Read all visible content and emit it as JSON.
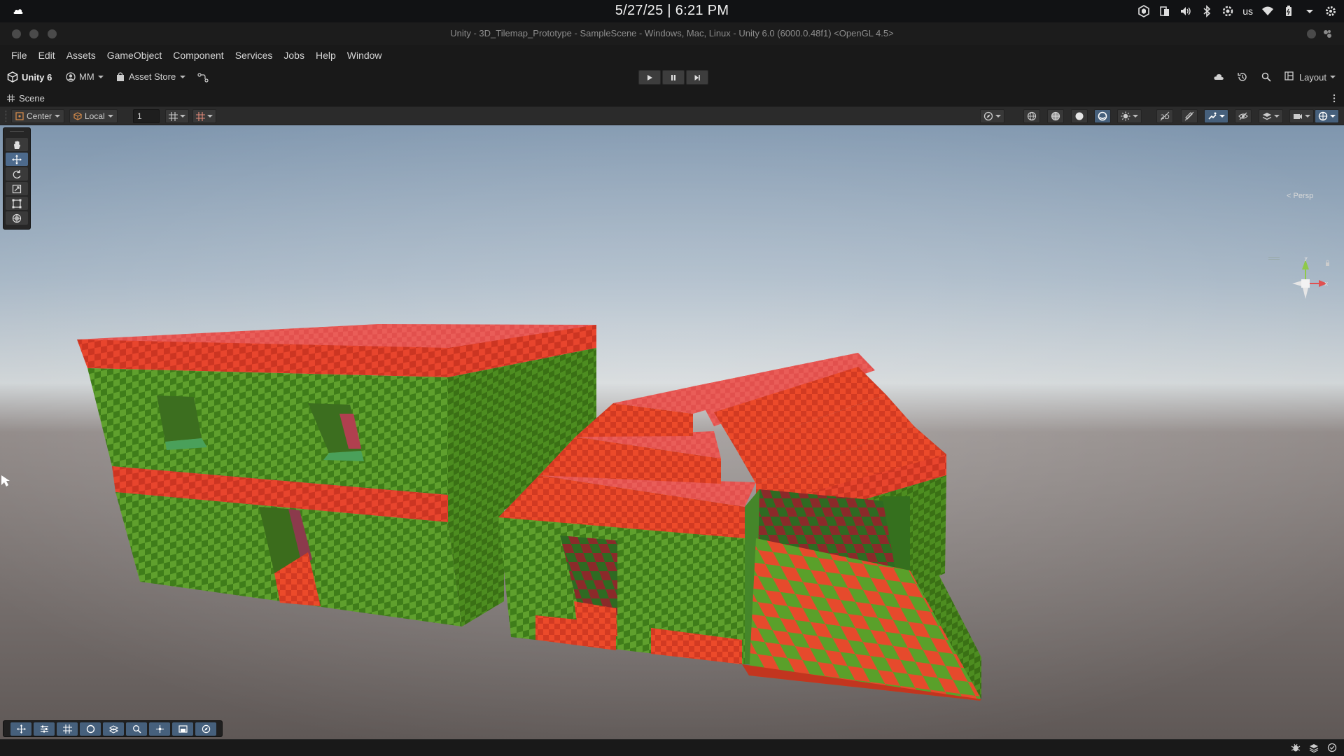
{
  "os_bar": {
    "clock": "5/27/25 | 6:21 PM",
    "keyboard_layout": "us",
    "tray_icons": [
      "app-indicator-icon",
      "clipboard-icon",
      "volume-icon",
      "bluetooth-icon",
      "settings-icon",
      "wifi-icon",
      "battery-icon",
      "dropdown-icon",
      "gear-icon"
    ]
  },
  "window": {
    "title": "Unity - 3D_Tilemap_Prototype - SampleScene - Windows, Mac, Linux - Unity 6.0 (6000.0.48f1) <OpenGL 4.5>"
  },
  "menu": {
    "items": [
      "File",
      "Edit",
      "Assets",
      "GameObject",
      "Component",
      "Services",
      "Jobs",
      "Help",
      "Window"
    ]
  },
  "toolbar": {
    "unity_label": "Unity 6",
    "account_label": "MM",
    "asset_store_label": "Asset Store",
    "layout_label": "Layout"
  },
  "scene_tab": {
    "label": "Scene"
  },
  "scene_toolbar": {
    "pivot_mode": "Center",
    "pivot_rotation": "Local",
    "grid_size": "1"
  },
  "gizmo": {
    "projection_label": "< Persp",
    "axis_labels": {
      "y": "y",
      "x": "x"
    },
    "colors": {
      "y": "#8fc94a",
      "x": "#e05050",
      "z": "#d9d9d9"
    }
  },
  "colors": {
    "checker_green": "#5fa427",
    "checker_red": "#e8452d",
    "roof_pink": "#e65a55",
    "sky_top": "#7f96ae",
    "ground": "#6c6562",
    "active_tool": "#4d6a8c"
  }
}
